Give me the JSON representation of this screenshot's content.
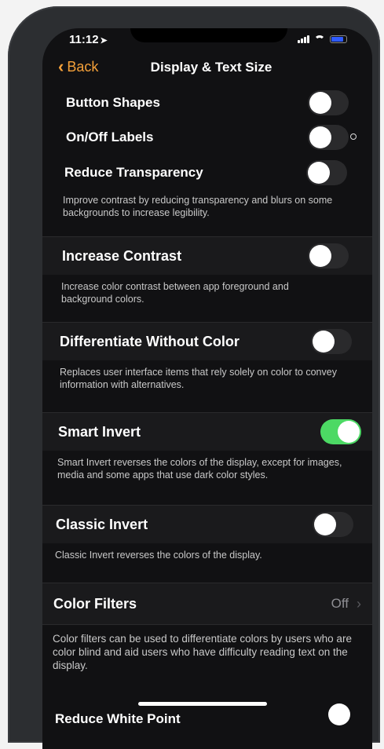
{
  "status": {
    "time": "11:12"
  },
  "nav": {
    "back_label": "Back",
    "title": "Display & Text Size"
  },
  "settings": [
    {
      "label": "Button Shapes",
      "on": false
    },
    {
      "label": "On/Off Labels",
      "on": false
    },
    {
      "label": "Reduce Transparency",
      "on": false,
      "description": "Improve contrast by reducing transparency and blurs on some backgrounds to increase legibility."
    },
    {
      "label": "Increase Contrast",
      "on": false,
      "description": "Increase color contrast between app foreground and background colors."
    },
    {
      "label": "Differentiate Without Color",
      "on": false,
      "description": "Replaces user interface items that rely solely on color to convey information with alternatives."
    },
    {
      "label": "Smart Invert",
      "on": true,
      "description": "Smart Invert reverses the colors of the display, except for images, media and some apps that use dark color styles."
    },
    {
      "label": "Classic Invert",
      "on": false,
      "description": "Classic Invert reverses the colors of the display."
    },
    {
      "label": "Color Filters",
      "value": "Off",
      "description": "Color filters can be used to differentiate colors by users who are color blind and aid users who have difficulty reading text on the display."
    }
  ],
  "partial_row": {
    "label": "Reduce White Point"
  },
  "colors": {
    "accent": "#f5a13a",
    "toggle_on": "#4cd964",
    "background": "#111113"
  }
}
